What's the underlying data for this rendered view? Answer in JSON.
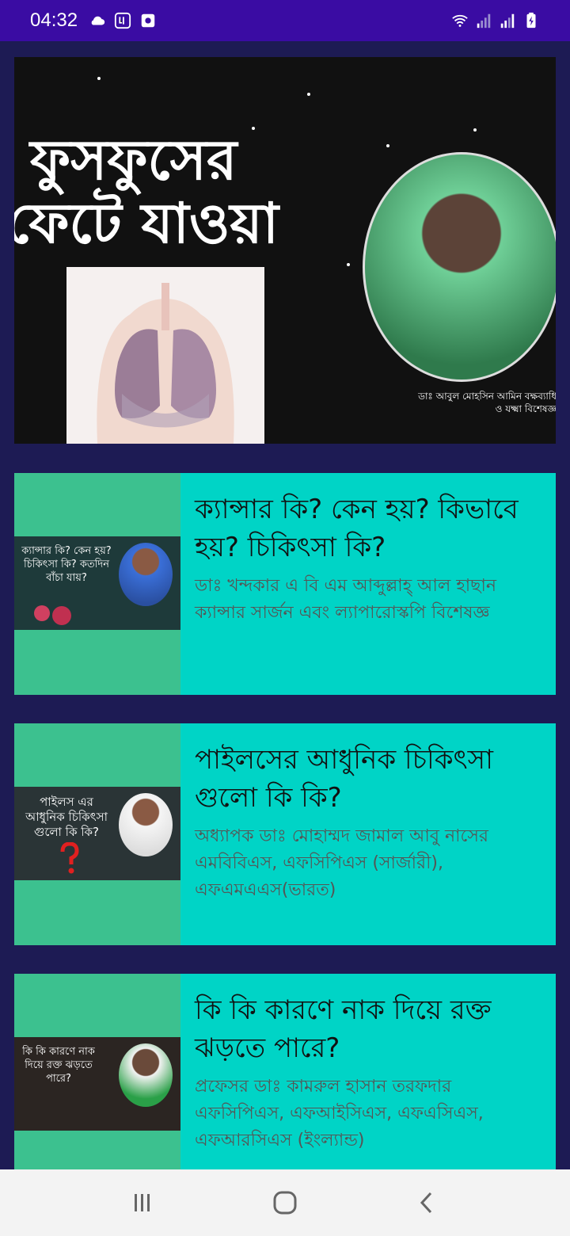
{
  "status_bar": {
    "time": "04:32"
  },
  "hero": {
    "title_line1": "ফুসফুসের",
    "title_line2": "ফেটে যাওয়া",
    "caption": "ডাঃ আবুল মোহসিন আমিন বক্ষব্যাধি ও যক্ষ্মা বিশেষজ্ঞ"
  },
  "cards": [
    {
      "thumb_text": "ক্যান্সার কি? কেন হয়? চিকিৎসা কি? কতদিন বাঁচা যায়?",
      "title": "ক্যান্সার কি? কেন হয়? কিভাবে হয়? চিকিৎসা কি?",
      "description": "ডাঃ খন্দকার এ বি এম আব্দুল্লাহ্ আল হাছান ক্যান্সার সার্জন এবং ল্যাপারোস্কপি বিশেষজ্ঞ"
    },
    {
      "thumb_text": "পাইলস এর আধুনিক চিকিৎসা গুলো কি কি?",
      "title": "পাইলসের আধুনিক চিকিৎসা গুলো কি কি?",
      "description": "অধ্যাপক ডাঃ মোহাম্মদ জামাল আবু নাসের এমবিবিএস, এফসিপিএস (সার্জারী), এফএমএএস(ভারত)"
    },
    {
      "thumb_text": "কি কি কারণে নাক দিয়ে রক্ত ঝড়তে পারে?",
      "title": "কি কি কারণে নাক দিয়ে রক্ত ঝড়তে পারে?",
      "description": "প্রফেসর ডাঃ কামরুল হাসান তরফদার এফসিপিএস, এফআইসিএস, এফএসিএস, এফআরসিএস (ইংল্যান্ড)"
    }
  ],
  "colors": {
    "status_bar": "#3a0ca3",
    "background": "#1d1b54",
    "card_bg": "#00d4c6",
    "card_thumb_area": "#3cc18f",
    "nav_bar": "#f3f3f3"
  }
}
